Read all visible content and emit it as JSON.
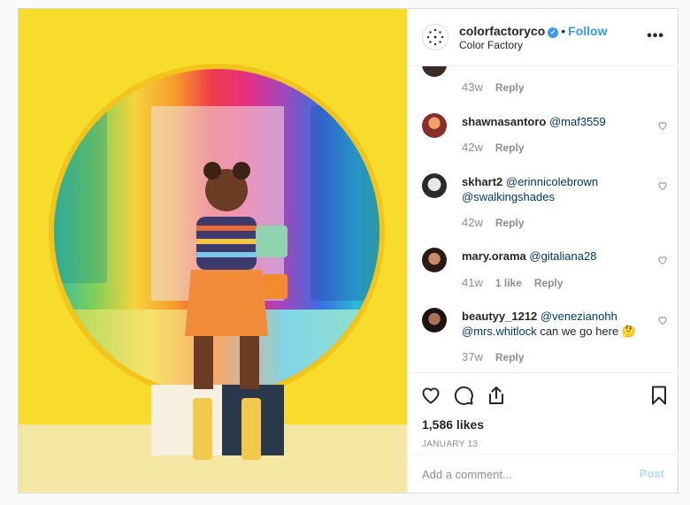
{
  "header": {
    "username": "colorfactoryco",
    "verified": "✓",
    "separator": "•",
    "follow_label": "Follow",
    "subtitle": "Color Factory",
    "more_label": "•••"
  },
  "comments": [
    {
      "time": "43w",
      "reply": "Reply"
    },
    {
      "username": "shawnasantoro",
      "mentions": [
        "@maf3559"
      ],
      "time": "42w",
      "reply": "Reply"
    },
    {
      "username": "skhart2",
      "mentions": [
        "@erinnicolebrown",
        "@swalkingshades"
      ],
      "time": "42w",
      "reply": "Reply"
    },
    {
      "username": "mary.orama",
      "mentions": [
        "@gitaliana28"
      ],
      "time": "41w",
      "likes": "1 like",
      "reply": "Reply"
    },
    {
      "username": "beautyy_1212",
      "mentions": [
        "@venezianohh",
        "@mrs.whitlock"
      ],
      "text": "can we go here",
      "emoji": "🤔",
      "time": "37w",
      "reply": "Reply"
    }
  ],
  "actions": {
    "icons": [
      "heart-icon",
      "comment-icon",
      "share-icon",
      "bookmark-icon"
    ],
    "likes": "1,586 likes",
    "date": "JANUARY 13"
  },
  "add_comment": {
    "placeholder": "Add a comment...",
    "post_label": "Post"
  },
  "colors": {
    "accent": "#3897f0",
    "post_disabled": "#b3dbff",
    "mention": "#00376b",
    "muted": "#8e8e8e",
    "photo_background": "#f7dc2b"
  }
}
